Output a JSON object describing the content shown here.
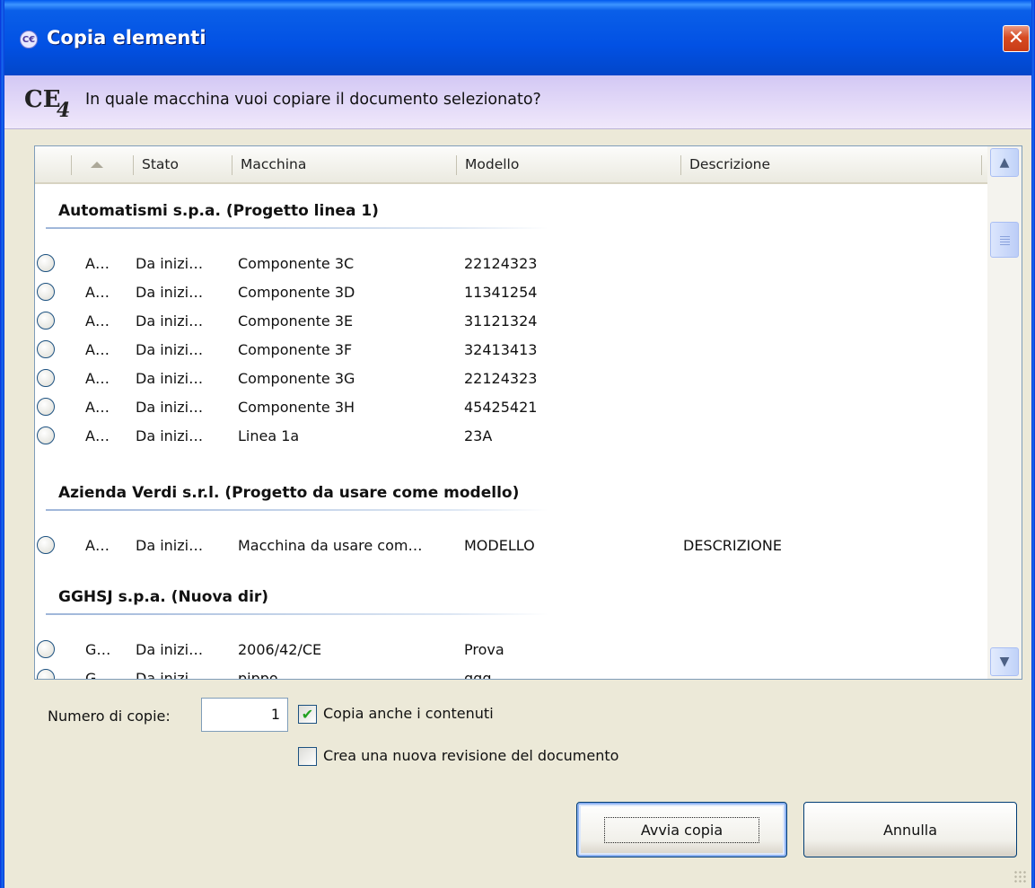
{
  "window": {
    "title": "Copia elementi",
    "icon": "ce-app-icon",
    "close": "✕"
  },
  "header": {
    "logo_text": "CE",
    "logo_sub": "4",
    "question": "In quale macchina vuoi copiare il documento selezionato?"
  },
  "columns": {
    "sort": "",
    "stato": "Stato",
    "macchina": "Macchina",
    "modello": "Modello",
    "descrizione": "Descrizione"
  },
  "groups": [
    {
      "title": "Automatismi s.p.a. (Progetto linea 1)",
      "rows": [
        {
          "c1": "A…",
          "stato": "Da inizi…",
          "macchina": "Componente 3C",
          "modello": "22124323",
          "descrizione": ""
        },
        {
          "c1": "A…",
          "stato": "Da inizi…",
          "macchina": "Componente 3D",
          "modello": "11341254",
          "descrizione": ""
        },
        {
          "c1": "A…",
          "stato": "Da inizi…",
          "macchina": "Componente 3E",
          "modello": "31121324",
          "descrizione": ""
        },
        {
          "c1": "A…",
          "stato": "Da inizi…",
          "macchina": "Componente 3F",
          "modello": "32413413",
          "descrizione": ""
        },
        {
          "c1": "A…",
          "stato": "Da inizi…",
          "macchina": "Componente 3G",
          "modello": "22124323",
          "descrizione": ""
        },
        {
          "c1": "A…",
          "stato": "Da inizi…",
          "macchina": "Componente 3H",
          "modello": "45425421",
          "descrizione": ""
        },
        {
          "c1": "A…",
          "stato": "Da inizi…",
          "macchina": "Linea 1a",
          "modello": "23A",
          "descrizione": ""
        }
      ]
    },
    {
      "title": "Azienda Verdi s.r.l. (Progetto da usare come modello)",
      "rows": [
        {
          "c1": "A…",
          "stato": "Da inizi…",
          "macchina": "Macchina da usare com…",
          "modello": "MODELLO",
          "descrizione": "DESCRIZIONE"
        }
      ]
    },
    {
      "title": "GGHSJ s.p.a. (Nuova dir)",
      "rows": [
        {
          "c1": "G…",
          "stato": "Da inizi…",
          "macchina": "2006/42/CE",
          "modello": "Prova",
          "descrizione": ""
        },
        {
          "c1": "G…",
          "stato": "Da inizi…",
          "macchina": "pippo",
          "modello": "ggg",
          "descrizione": ""
        }
      ]
    }
  ],
  "copies": {
    "label": "Numero di copie:",
    "value": "1"
  },
  "options": {
    "copy_contents": {
      "label": "Copia anche i contenuti",
      "checked": true
    },
    "new_revision": {
      "label": "Crea una nuova revisione del documento",
      "checked": false
    }
  },
  "buttons": {
    "start": "Avvia copia",
    "cancel": "Annulla"
  }
}
